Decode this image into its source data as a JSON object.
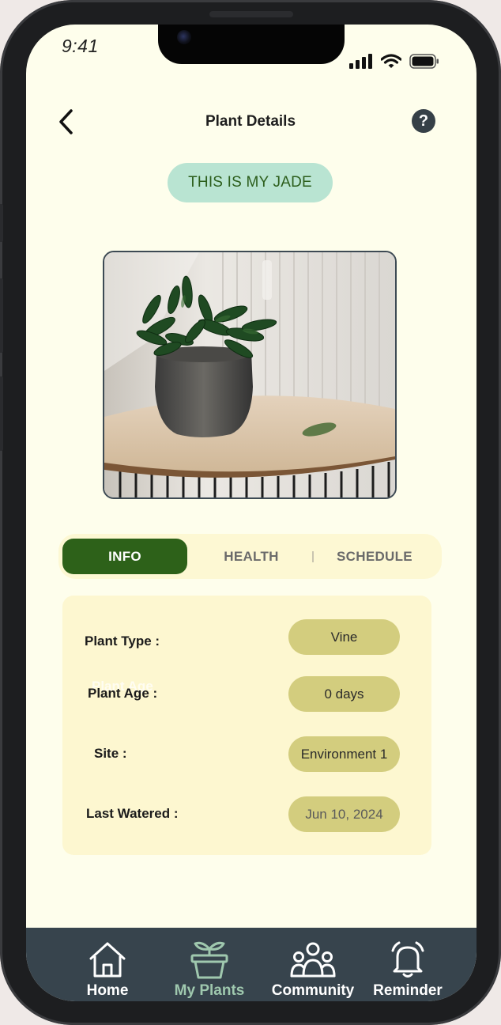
{
  "status_bar": {
    "time": "9:41"
  },
  "header": {
    "title": "Plant Details",
    "help_symbol": "?"
  },
  "plant": {
    "nickname": "THIS IS MY JADE"
  },
  "tabs": [
    {
      "label": "INFO",
      "active": true
    },
    {
      "label": "HEALTH",
      "active": false
    },
    {
      "label": "SCHEDULE",
      "active": false
    }
  ],
  "info": {
    "rows": [
      {
        "label": "Plant Type :",
        "value": "Vine"
      },
      {
        "label": "Plant Age :",
        "value": "0 days"
      },
      {
        "label": "Site :",
        "value": "Environment 1"
      },
      {
        "label": "Last Watered :",
        "value": "Jun 10, 2024"
      }
    ],
    "ghost_label": "Plant Age"
  },
  "bottom_nav": {
    "items": [
      {
        "label": "Home",
        "icon": "home-icon",
        "active": false
      },
      {
        "label": "My Plants",
        "icon": "plant-pot-icon",
        "active": true
      },
      {
        "label": "Community",
        "icon": "community-icon",
        "active": false
      },
      {
        "label": "Reminder",
        "icon": "alarm-bell-icon",
        "active": false
      }
    ]
  },
  "colors": {
    "background": "#fefeec",
    "accent_green": "#2d6119",
    "name_pill": "#b9e4d2",
    "value_pill": "#d3cd7e",
    "nav_bar": "#37444d",
    "nav_active": "#9fc8ae"
  }
}
